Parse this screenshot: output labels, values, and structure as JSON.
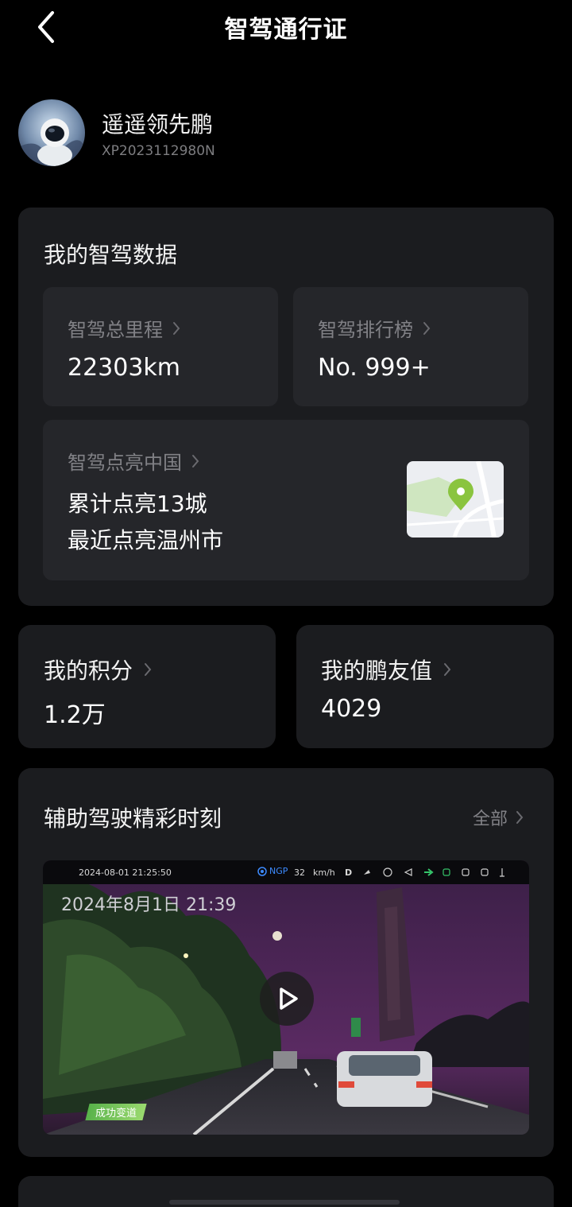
{
  "header": {
    "title": "智驾通行证"
  },
  "profile": {
    "name": "遥遥领先鹏",
    "id": "XP2023112980N"
  },
  "driving_data": {
    "title": "我的智驾数据",
    "mileage": {
      "label": "智驾总里程",
      "value": "22303km"
    },
    "ranking": {
      "label": "智驾排行榜",
      "value": "No. 999+"
    },
    "china": {
      "label": "智驾点亮中国",
      "line1": "累计点亮13城",
      "line2": "最近点亮温州市"
    }
  },
  "points": {
    "label": "我的积分",
    "value": "1.2万"
  },
  "friend_value": {
    "label": "我的鹏友值",
    "value": "4029"
  },
  "highlights": {
    "title": "辅助驾驶精彩时刻",
    "all_label": "全部",
    "video": {
      "hud_datetime": "2024-08-01    21:25:50",
      "hud_ngp": "NGP",
      "hud_speed": "32",
      "hud_unit": "km/h",
      "hud_gear": "D",
      "date": "2024年8月1日 21:39",
      "tag": "成功变道"
    }
  },
  "colors": {
    "background": "#000000",
    "card": "#1b1c1f",
    "inner_card": "#25262a",
    "accent_green": "#8ac43f"
  }
}
